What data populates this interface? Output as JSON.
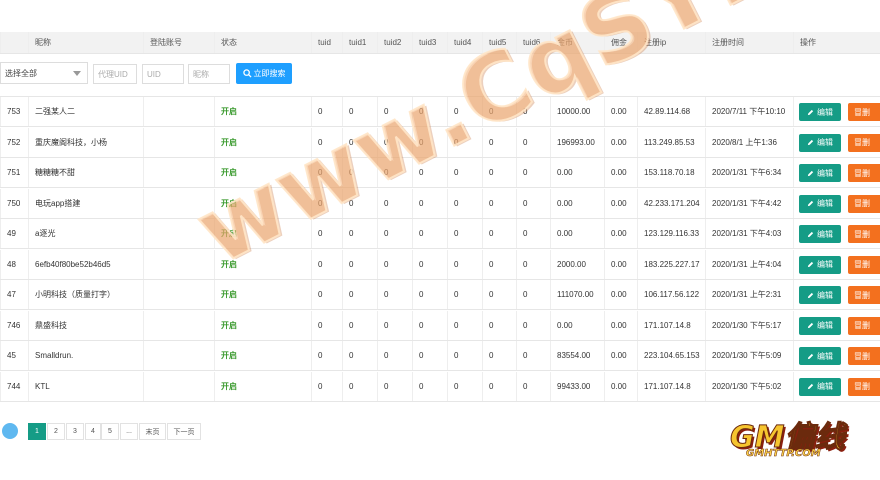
{
  "table": {
    "headers": [
      "",
      "昵称",
      "登陆账号",
      "状态",
      "tuid",
      "tuid1",
      "tuid2",
      "tuid3",
      "tuid4",
      "tuid5",
      "tuid6",
      "金币",
      "佣金",
      "注册ip",
      "注册时间",
      "操作"
    ],
    "rows": [
      {
        "id": "753",
        "nickname": "二强某人二",
        "account": "",
        "status": "开启",
        "tuid": "0",
        "tuid1": "0",
        "tuid2": "0",
        "tuid3": "0",
        "tuid4": "0",
        "tuid5": "0",
        "tuid6": "0",
        "gold": "10000.00",
        "commission": "0.00",
        "ip": "42.89.114.68",
        "time": "2020/7/11 下午10:10"
      },
      {
        "id": "752",
        "nickname": "重庆魔阁科技，小杨",
        "account": "",
        "status": "开启",
        "tuid": "0",
        "tuid1": "0",
        "tuid2": "0",
        "tuid3": "0",
        "tuid4": "0",
        "tuid5": "0",
        "tuid6": "0",
        "gold": "196993.00",
        "commission": "0.00",
        "ip": "113.249.85.53",
        "time": "2020/8/1 上午1:36"
      },
      {
        "id": "751",
        "nickname": "糖糖糖不甜",
        "account": "",
        "status": "开启",
        "tuid": "0",
        "tuid1": "0",
        "tuid2": "0",
        "tuid3": "0",
        "tuid4": "0",
        "tuid5": "0",
        "tuid6": "0",
        "gold": "0.00",
        "commission": "0.00",
        "ip": "153.118.70.18",
        "time": "2020/1/31 下午6:34"
      },
      {
        "id": "750",
        "nickname": "电玩app搭建",
        "account": "",
        "status": "开启",
        "tuid": "0",
        "tuid1": "0",
        "tuid2": "0",
        "tuid3": "0",
        "tuid4": "0",
        "tuid5": "0",
        "tuid6": "0",
        "gold": "0.00",
        "commission": "0.00",
        "ip": "42.233.171.204",
        "time": "2020/1/31 下午4:42"
      },
      {
        "id": "49",
        "nickname": "a逐光",
        "account": "",
        "status": "开启",
        "tuid": "0",
        "tuid1": "0",
        "tuid2": "0",
        "tuid3": "0",
        "tuid4": "0",
        "tuid5": "0",
        "tuid6": "0",
        "gold": "0.00",
        "commission": "0.00",
        "ip": "123.129.116.33",
        "time": "2020/1/31 下午4:03"
      },
      {
        "id": "48",
        "nickname": "6efb40f80be52b46d5",
        "account": "",
        "status": "开启",
        "tuid": "0",
        "tuid1": "0",
        "tuid2": "0",
        "tuid3": "0",
        "tuid4": "0",
        "tuid5": "0",
        "tuid6": "0",
        "gold": "2000.00",
        "commission": "0.00",
        "ip": "183.225.227.17",
        "time": "2020/1/31 上午4:04"
      },
      {
        "id": "47",
        "nickname": "小明科技（质量打字）",
        "account": "",
        "status": "开启",
        "tuid": "0",
        "tuid1": "0",
        "tuid2": "0",
        "tuid3": "0",
        "tuid4": "0",
        "tuid5": "0",
        "tuid6": "0",
        "gold": "111070.00",
        "commission": "0.00",
        "ip": "106.117.56.122",
        "time": "2020/1/31 上午2:31"
      },
      {
        "id": "746",
        "nickname": "鼎盛科技",
        "account": "",
        "status": "开启",
        "tuid": "0",
        "tuid1": "0",
        "tuid2": "0",
        "tuid3": "0",
        "tuid4": "0",
        "tuid5": "0",
        "tuid6": "0",
        "gold": "0.00",
        "commission": "0.00",
        "ip": "171.107.14.8",
        "time": "2020/1/30 下午5:17"
      },
      {
        "id": "45",
        "nickname": "Smalldrun.",
        "account": "",
        "status": "开启",
        "tuid": "0",
        "tuid1": "0",
        "tuid2": "0",
        "tuid3": "0",
        "tuid4": "0",
        "tuid5": "0",
        "tuid6": "0",
        "gold": "83554.00",
        "commission": "0.00",
        "ip": "223.104.65.153",
        "time": "2020/1/30 下午5:09"
      },
      {
        "id": "744",
        "nickname": "KTL",
        "account": "",
        "status": "开启",
        "tuid": "0",
        "tuid1": "0",
        "tuid2": "0",
        "tuid3": "0",
        "tuid4": "0",
        "tuid5": "0",
        "tuid6": "0",
        "gold": "99433.00",
        "commission": "0.00",
        "ip": "171.107.14.8",
        "time": "2020/1/30 下午5:02"
      }
    ],
    "edit_label": "编辑",
    "delete_label": "冒删"
  },
  "filters": {
    "select_value": "选择全部",
    "agent_uid_placeholder": "代理UID",
    "uid_placeholder": "UID",
    "nickname_placeholder": "昵称",
    "search_label": "立即搜索"
  },
  "pagination": {
    "pages": [
      "1",
      "2",
      "3",
      "4",
      "5",
      "...",
      "末页",
      "下一页"
    ],
    "active": "1"
  },
  "watermark": "www.CqSYBB.Com",
  "logo": {
    "main": "GM偏线",
    "sub": "GMHTTP.COM"
  },
  "colors": {
    "edit": "#159c86",
    "delete": "#f3701e",
    "search": "#1e9fff",
    "status_on": "#3a9a2e"
  }
}
